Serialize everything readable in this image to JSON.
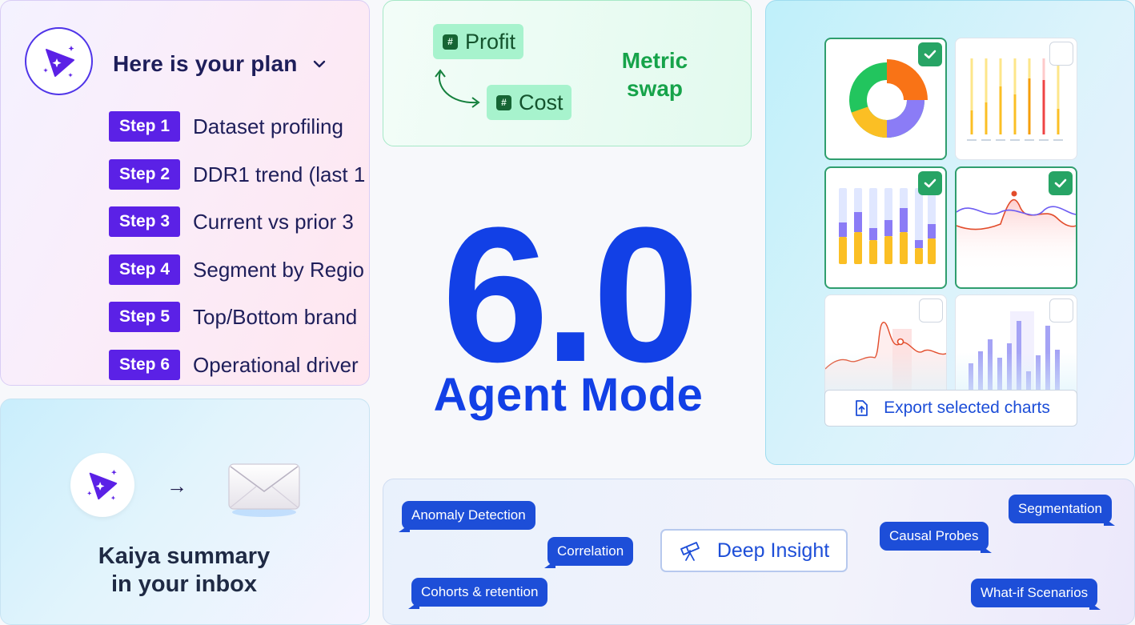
{
  "plan": {
    "title": "Here is your plan",
    "steps": [
      {
        "badge": "Step 1",
        "text": "Dataset profiling"
      },
      {
        "badge": "Step 2",
        "text": "DDR1 trend (last 1"
      },
      {
        "badge": "Step 3",
        "text": "Current vs prior 3"
      },
      {
        "badge": "Step 4",
        "text": "Segment by Regio"
      },
      {
        "badge": "Step 5",
        "text": "Top/Bottom brand"
      },
      {
        "badge": "Step 6",
        "text": "Operational driver"
      }
    ]
  },
  "metric_swap": {
    "from": "Profit",
    "to": "Cost",
    "label": "Metric swap"
  },
  "hero": {
    "version": "6.0",
    "subtitle": "Agent Mode"
  },
  "charts_panel": {
    "tiles": [
      {
        "name": "donut",
        "selected": true
      },
      {
        "name": "lollipop",
        "selected": false
      },
      {
        "name": "stacked-bars",
        "selected": true
      },
      {
        "name": "area-line",
        "selected": true
      },
      {
        "name": "line-spike",
        "selected": false
      },
      {
        "name": "faded-bars",
        "selected": false
      }
    ],
    "export_label": "Export selected charts"
  },
  "inbox": {
    "line1": "Kaiya summary",
    "line2": "in your inbox",
    "arrow": "→"
  },
  "insights": {
    "center_label": "Deep Insight",
    "chips": [
      "Anomaly Detection",
      "Correlation",
      "Cohorts & retention",
      "Causal Probes",
      "Segmentation",
      "What-if Scenarios"
    ]
  },
  "colors": {
    "brand_blue": "#1240e6",
    "step_purple": "#5b21e6",
    "green": "#16a34a",
    "chip_blue": "#1d4ed8"
  }
}
